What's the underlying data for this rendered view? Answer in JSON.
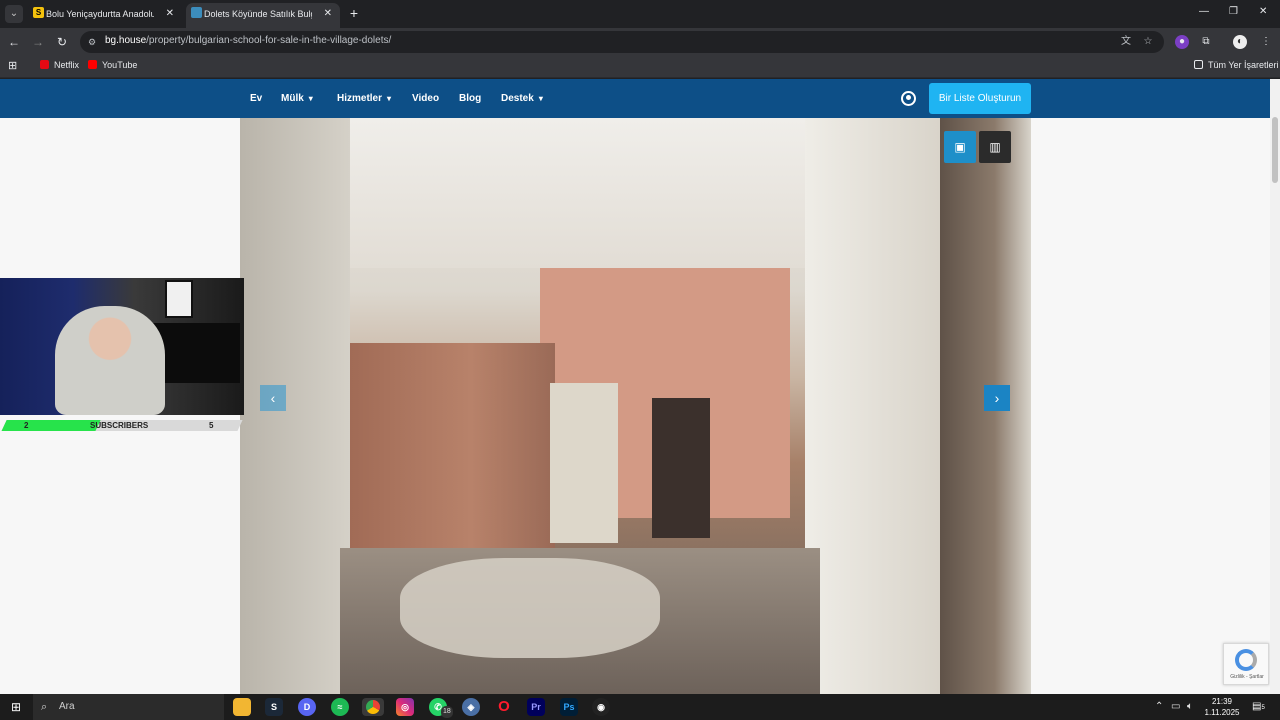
{
  "browser": {
    "tabs": [
      {
        "title": "Bolu Yeniçaydurtta Anadolu Of",
        "favicon_color": "#f4c20d",
        "active": false
      },
      {
        "title": "Dolets Köyünde Satılık Bulgar O",
        "favicon_color": "#3c8dbc",
        "active": true
      }
    ],
    "new_tab": "+",
    "url_host": "bg.house",
    "url_path": "/property/bulgarian-school-for-sale-in-the-village-dolets/",
    "bookmarks": [
      "Netflix",
      "YouTube"
    ],
    "all_bookmarks": "Tüm Yer İşaretleri"
  },
  "site": {
    "menu": [
      {
        "label": "Ev",
        "has_dropdown": false
      },
      {
        "label": "Mülk",
        "has_dropdown": true
      },
      {
        "label": "Hizmetler",
        "has_dropdown": true
      },
      {
        "label": "Video",
        "has_dropdown": false
      },
      {
        "label": "Blog",
        "has_dropdown": false
      },
      {
        "label": "Destek",
        "has_dropdown": true
      }
    ],
    "cta": "Bir Liste Oluşturun",
    "brand_color": "#0d4f87",
    "accent_color": "#1fb4f2"
  },
  "overlay": {
    "subscribers_label": "SUBSCRIBERS",
    "current": "2",
    "goal": "5",
    "progress": 0.4
  },
  "recaptcha": {
    "text": "Gizlilik - Şartlar"
  },
  "taskbar": {
    "search_placeholder": "Ara",
    "whatsapp_badge": "18",
    "time": "21:39",
    "date": "1.11.2025",
    "notifications": "5"
  }
}
